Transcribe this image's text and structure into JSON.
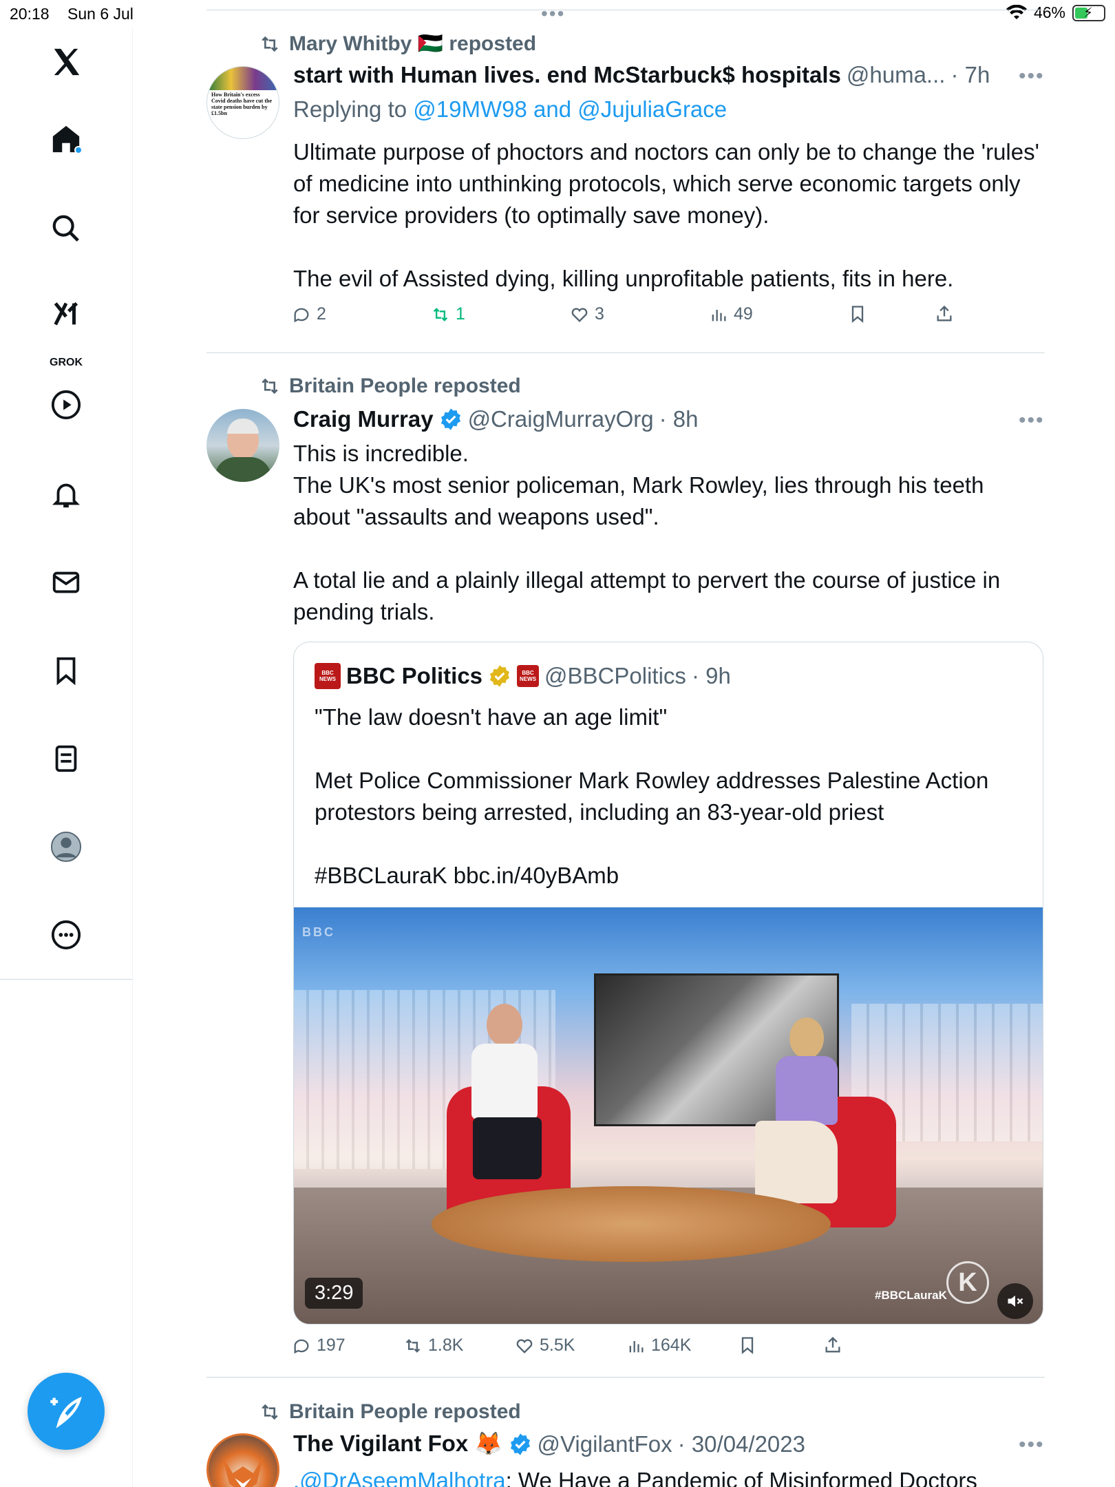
{
  "status_bar": {
    "time": "20:18",
    "date": "Sun 6 Jul",
    "battery": "46%"
  },
  "sidebar": {
    "grok_label": "GROK"
  },
  "tweets": [
    {
      "repost_by": "Mary Whitby 🇵🇸 reposted",
      "name": "start with Human lives. end McStarbuck$ hospitals",
      "handle": "@huma...",
      "time": "· 7h",
      "replying_prefix": "Replying to",
      "replying_to": "@19MW98 and @JujuliaGrace",
      "avatar_text": "How Britain's excess Covid deaths have cut the state pension burden by £1.5bn",
      "text": "Ultimate purpose of phoctors and noctors can only be to change the 'rules' of medicine into unthinking protocols, which serve economic targets only for service providers (to optimally save money).\n\nThe evil of Assisted dying, killing unprofitable patients, fits in here.",
      "replies": "2",
      "reposts": "1",
      "likes": "3",
      "views": "49"
    },
    {
      "repost_by": "Britain People reposted",
      "name": "Craig Murray",
      "handle": "@CraigMurrayOrg",
      "time": "· 8h",
      "text": "This is incredible.\nThe UK's most senior policeman, Mark Rowley, lies through his teeth about \"assaults and weapons used\".\n\nA total lie and a plainly illegal attempt to pervert the course of justice in pending trials.",
      "quote": {
        "name": "BBC Politics",
        "handle": "@BBCPolitics",
        "time": "· 9h",
        "logo_text": "BBC NEWS POLITICS",
        "text": "\"The law doesn't have an age limit\"\n\nMet Police Commissioner Mark Rowley addresses Palestine Action protestors being arrested, including an 83-year-old priest\n\n#BBCLauraK bbc.in/40yBAmb",
        "video": {
          "watermark": "BBC",
          "duration": "3:29",
          "hashtag": "#BBCLauraK",
          "logo": "K"
        }
      },
      "replies": "197",
      "reposts": "1.8K",
      "likes": "5.5K",
      "views": "164K"
    },
    {
      "repost_by": "Britain People reposted",
      "name": "The Vigilant Fox 🦊",
      "handle": "@VigilantFox",
      "time": "· 30/04/2023",
      "mention": ".@DrAseemMalhotra",
      "text_rest": ": We Have a Pandemic of Misinformed Doctors"
    }
  ],
  "colors": {
    "accent": "#1d9bf0",
    "text": "#0f1419",
    "secondary": "#536471",
    "repost_green": "#00ba7c",
    "bbc_red": "#bb1919"
  }
}
